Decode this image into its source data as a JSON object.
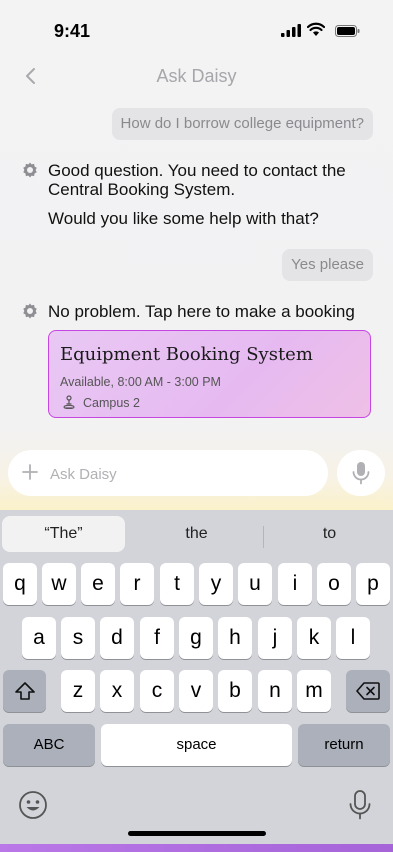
{
  "status": {
    "time": "9:41"
  },
  "header": {
    "title": "Ask Daisy"
  },
  "messages": {
    "user_1": "How do I borrow college equipment?",
    "bot_1_line1": "Good question. You need to contact the Central Booking System.",
    "bot_1_line2": "Would you like some help with that?",
    "user_2": "Yes please",
    "bot_2": "No problem. Tap here to make a booking"
  },
  "card": {
    "title": "Equipment Booking System",
    "availability": "Available, 8:00 AM - 3:00 PM",
    "location": "Campus 2"
  },
  "input": {
    "placeholder": "Ask Daisy"
  },
  "keyboard": {
    "suggestions": [
      "“The”",
      "the",
      "to"
    ],
    "row1": [
      "q",
      "w",
      "e",
      "r",
      "t",
      "y",
      "u",
      "i",
      "o",
      "p"
    ],
    "row2": [
      "a",
      "s",
      "d",
      "f",
      "g",
      "h",
      "j",
      "k",
      "l"
    ],
    "row3": [
      "z",
      "x",
      "c",
      "v",
      "b",
      "n",
      "m"
    ],
    "abc_label": "ABC",
    "space_label": "space",
    "return_label": "return"
  },
  "colors": {
    "card_border": "#c646e3",
    "card_fill": "#e8c2f3",
    "accent_glow": "#fbf1c9"
  },
  "icons": [
    "signal-icon",
    "wifi-icon",
    "battery-icon",
    "back-chevron-icon",
    "gear-icon",
    "person-pin-icon",
    "plus-icon",
    "mic-icon",
    "shift-icon",
    "delete-icon",
    "emoji-icon",
    "dictation-icon"
  ]
}
